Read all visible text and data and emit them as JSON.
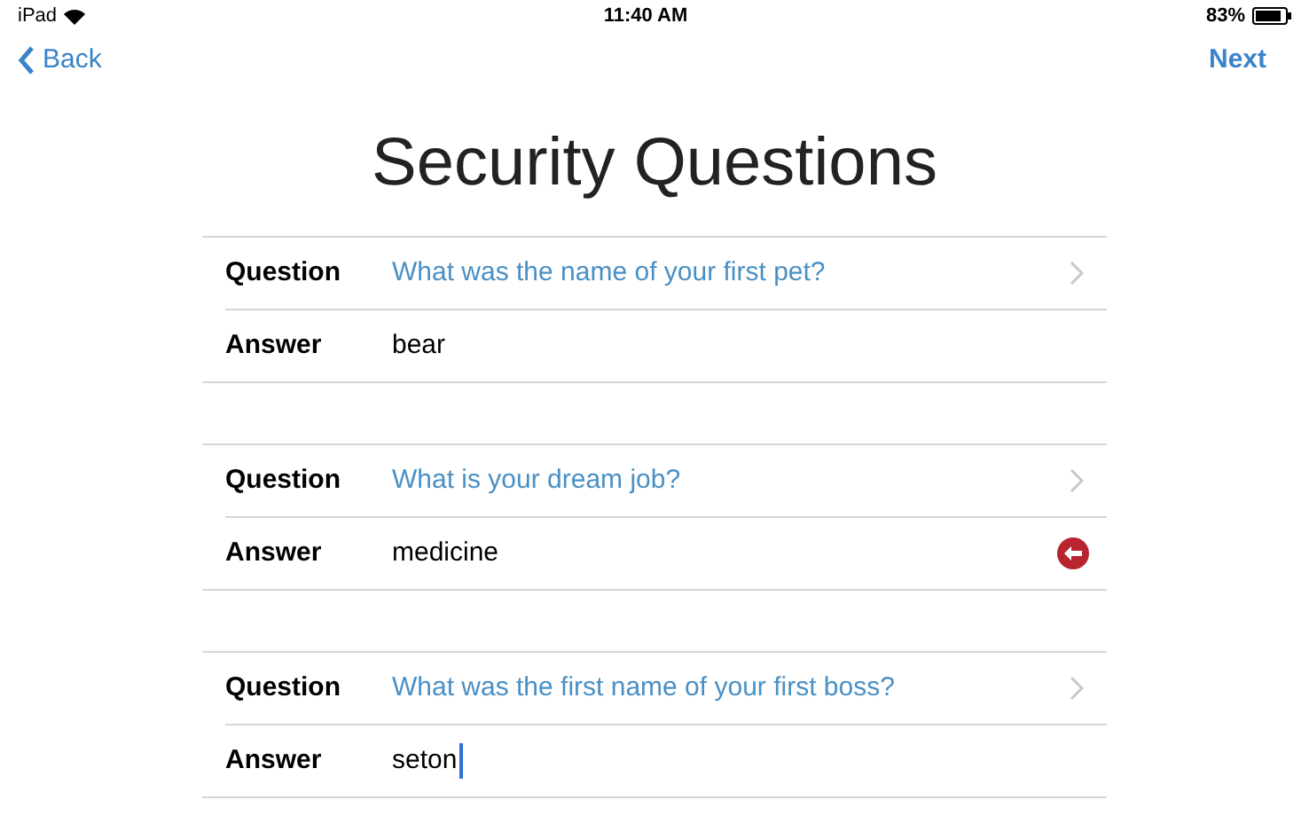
{
  "status_bar": {
    "device": "iPad",
    "time": "11:40 AM",
    "battery": "83%"
  },
  "nav": {
    "back": "Back",
    "next": "Next"
  },
  "title": "Security Questions",
  "groups": [
    {
      "question_label": "Question",
      "question": "What was the name of your first pet?",
      "answer_label": "Answer",
      "answer": "bear",
      "clear_button": false,
      "focused": false
    },
    {
      "question_label": "Question",
      "question": "What is your dream job?",
      "answer_label": "Answer",
      "answer": "medicine",
      "clear_button": true,
      "focused": false
    },
    {
      "question_label": "Question",
      "question": "What was the first name of your first boss?",
      "answer_label": "Answer",
      "answer": "seton",
      "clear_button": false,
      "focused": true
    }
  ]
}
